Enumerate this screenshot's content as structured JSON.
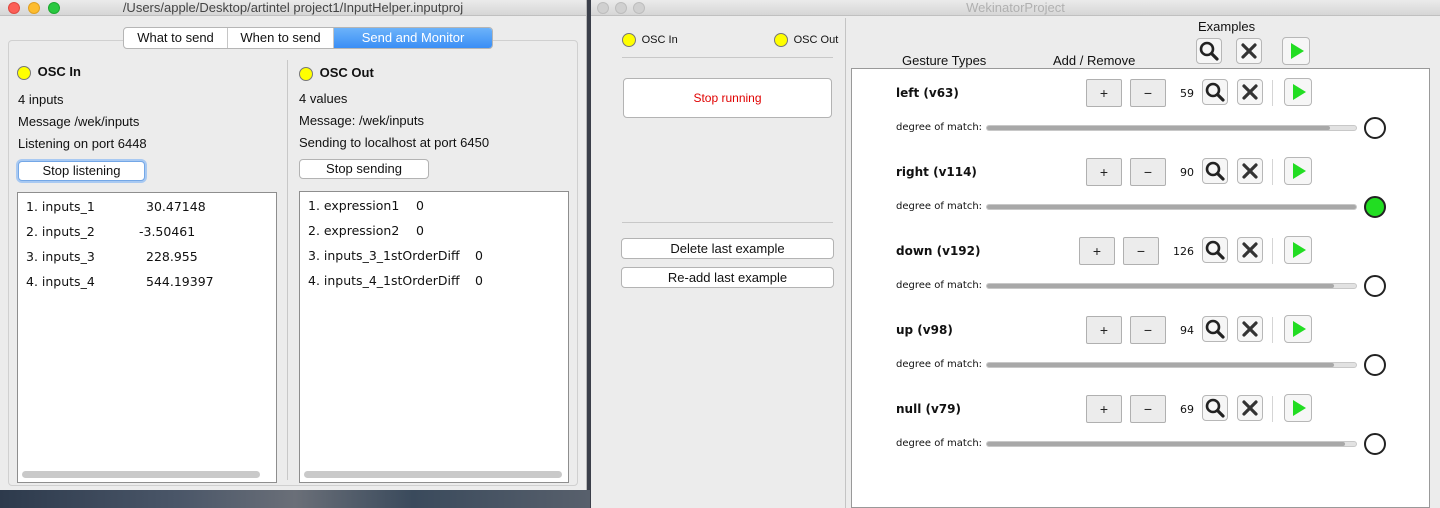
{
  "input_window": {
    "title": "/Users/apple/Desktop/artintel project1/InputHelper.inputproj",
    "tabs": [
      "What to send",
      "When to send",
      "Send and Monitor"
    ],
    "active_tab": "Send and Monitor",
    "osc_in": {
      "heading": "OSC In",
      "inputs_count": "4 inputs",
      "message": "Message /wek/inputs",
      "listening": "Listening on port 6448",
      "button": "Stop listening",
      "rows": [
        {
          "name": "1. inputs_1",
          "value": "30.47148"
        },
        {
          "name": "2. inputs_2",
          "value": "-3.50461"
        },
        {
          "name": "3. inputs_3",
          "value": "228.955"
        },
        {
          "name": "4. inputs_4",
          "value": "544.19397"
        }
      ]
    },
    "osc_out": {
      "heading": "OSC Out",
      "values_count": "4 values",
      "message": "Message: /wek/inputs",
      "sending": "Sending to localhost at port 6450",
      "button": "Stop sending",
      "rows": [
        {
          "name": "1. expression1",
          "value": "0"
        },
        {
          "name": "2. expression2",
          "value": "0"
        },
        {
          "name": "3. inputs_3_1stOrderDiff",
          "value": "0"
        },
        {
          "name": "4. inputs_4_1stOrderDiff",
          "value": "0"
        }
      ]
    }
  },
  "wekinator_window": {
    "title": "WekinatorProject",
    "osc_in_label": "OSC In",
    "osc_out_label": "OSC Out",
    "run_button": "Stop running",
    "delete_button": "Delete last example",
    "readd_button": "Re-add last example",
    "examples_label": "Examples",
    "gesture_types_label": "Gesture Types",
    "add_remove_label": "Add / Remove",
    "degree_label": "degree of match:",
    "gestures": [
      {
        "name": "left (v63)",
        "count": "59",
        "match": 0.93,
        "active": false
      },
      {
        "name": "right (v114)",
        "count": "90",
        "match": 1.0,
        "active": true
      },
      {
        "name": "down (v192)",
        "count": "126",
        "match": 0.94,
        "active": false
      },
      {
        "name": "up (v98)",
        "count": "94",
        "match": 0.94,
        "active": false
      },
      {
        "name": "null (v79)",
        "count": "69",
        "match": 0.97,
        "active": false
      }
    ],
    "colors": {
      "active": "#22dd22",
      "indicator": "#ffff00",
      "stop_text": "#e00000",
      "tab_active": "#3a8ef5"
    }
  }
}
